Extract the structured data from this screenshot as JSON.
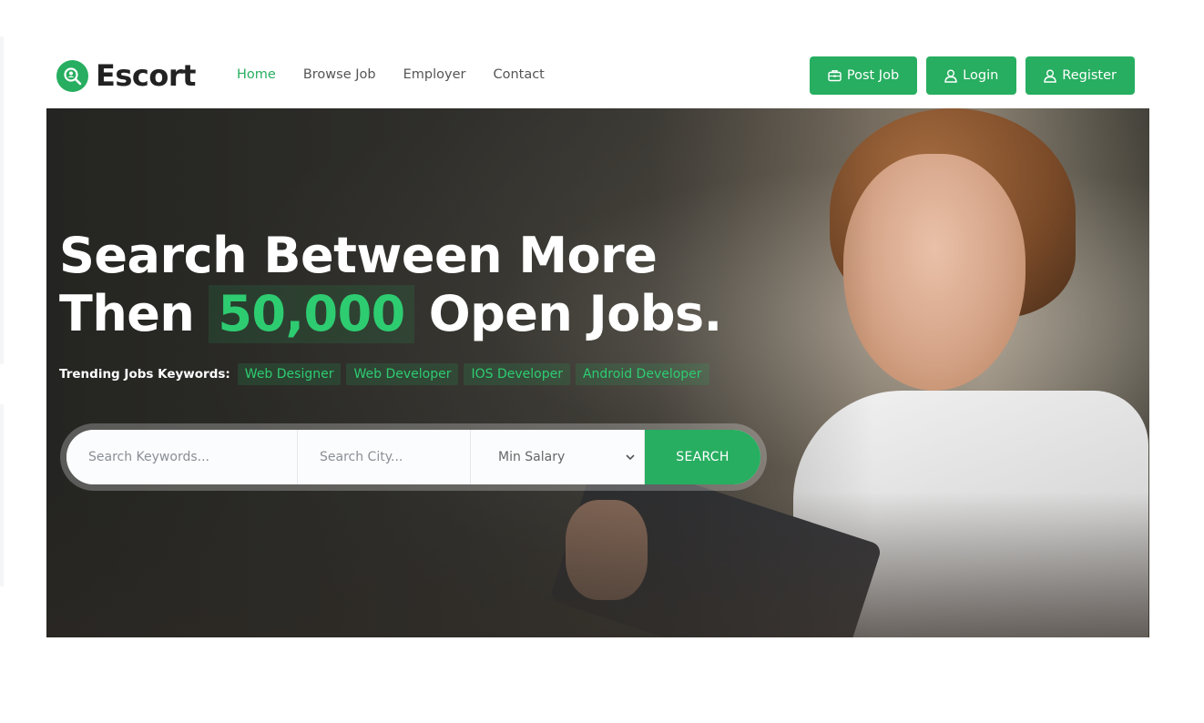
{
  "brand": {
    "name": "Escort",
    "icon": "search-person-icon"
  },
  "nav": {
    "items": [
      {
        "label": "Home",
        "active": true
      },
      {
        "label": "Browse Job",
        "active": false
      },
      {
        "label": "Employer",
        "active": false
      },
      {
        "label": "Contact",
        "active": false
      }
    ]
  },
  "header_buttons": [
    {
      "label": "Post Job",
      "icon": "briefcase-icon"
    },
    {
      "label": "Login",
      "icon": "user-icon"
    },
    {
      "label": "Register",
      "icon": "user-icon"
    }
  ],
  "hero": {
    "line1": "Search Between More",
    "line2_before": "Then",
    "line2_highlight": "50,000",
    "line2_after": "Open Jobs.",
    "trending_label": "Trending Jobs Keywords:",
    "trending": [
      "Web Designer",
      "Web Developer",
      "IOS Developer",
      "Android Developer"
    ]
  },
  "search": {
    "keywords_placeholder": "Search Keywords...",
    "city_placeholder": "Search City...",
    "salary_selected": "Min Salary",
    "button_label": "SEARCH"
  },
  "colors": {
    "accent": "#27ae60",
    "highlight": "#2ecc71",
    "text_dark": "#222222",
    "nav_text": "#555555"
  }
}
